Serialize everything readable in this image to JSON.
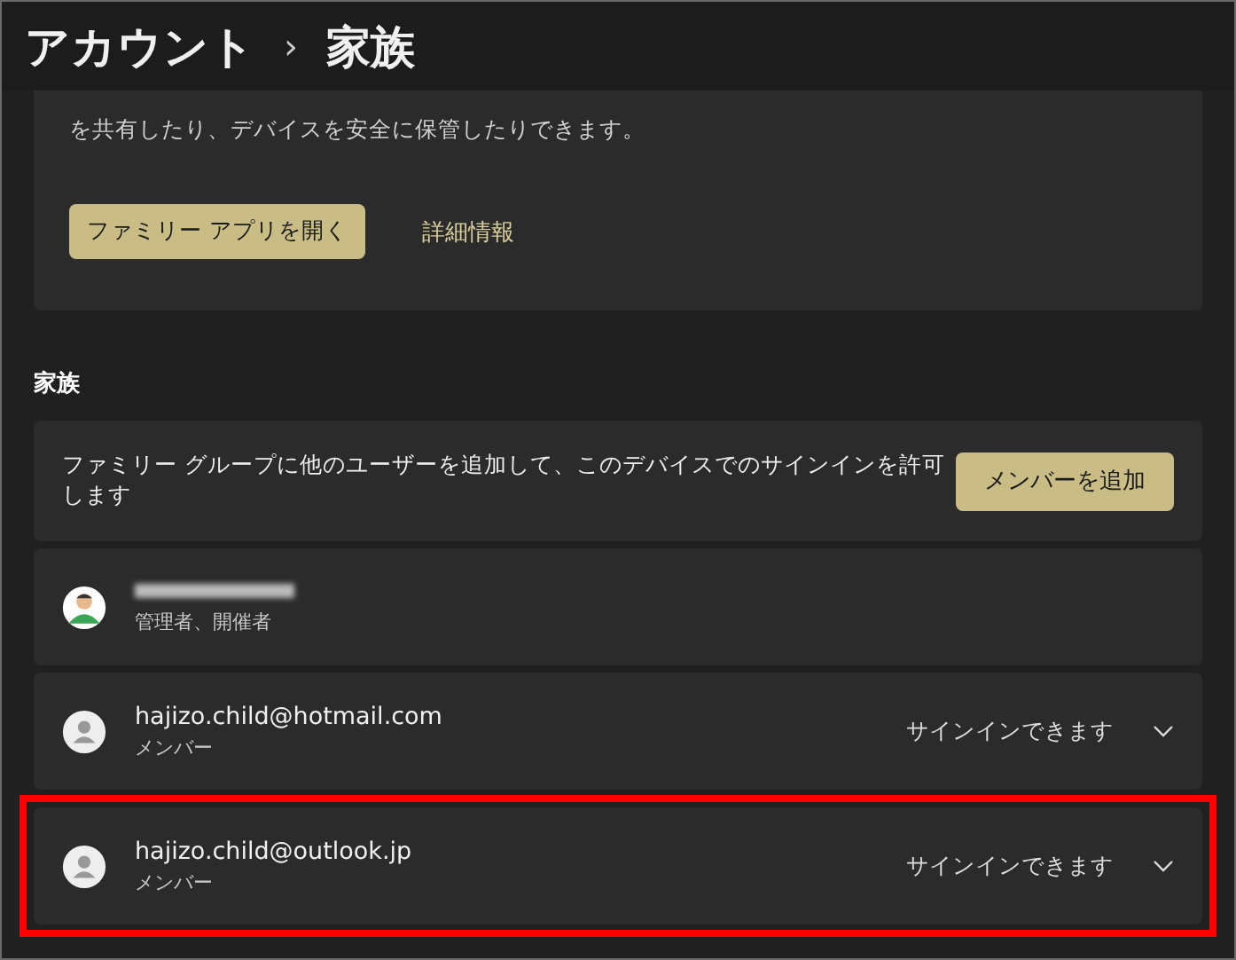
{
  "header": {
    "breadcrumb_parent": "アカウント",
    "separator": "›",
    "title": "家族"
  },
  "intro_card": {
    "description": "を共有したり、デバイスを安全に保管したりできます。",
    "primary_button": "ファミリー アプリを開く",
    "link": "詳細情報"
  },
  "section_title": "家族",
  "add_member": {
    "text": "ファミリー グループに他のユーザーを追加して、このデバイスでのサインインを許可します",
    "button": "メンバーを追加"
  },
  "members": [
    {
      "kind": "organizer",
      "role": "管理者、開催者",
      "highlighted": false
    },
    {
      "kind": "member",
      "email": "hajizo.child@hotmail.com",
      "role": "メンバー",
      "status": "サインインできます",
      "highlighted": false
    },
    {
      "kind": "member",
      "email": "hajizo.child@outlook.jp",
      "role": "メンバー",
      "status": "サインインできます",
      "highlighted": true
    }
  ]
}
